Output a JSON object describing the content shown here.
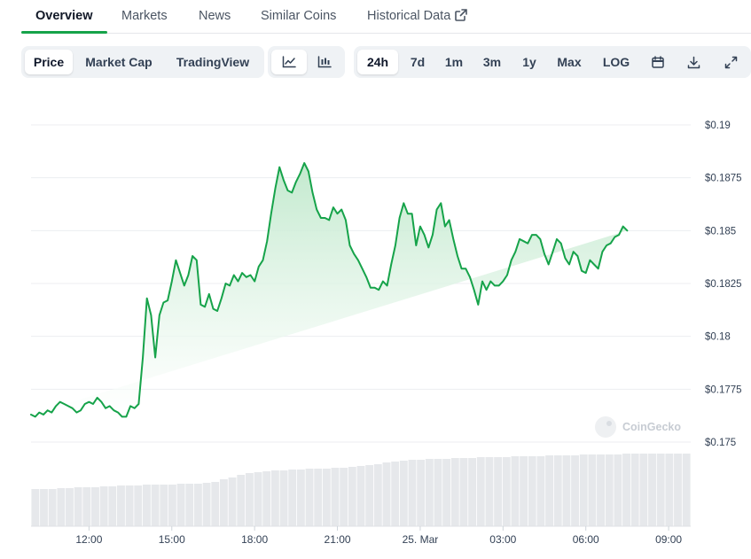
{
  "nav": {
    "tabs": [
      {
        "label": "Overview",
        "active": true
      },
      {
        "label": "Markets",
        "active": false
      },
      {
        "label": "News",
        "active": false
      },
      {
        "label": "Similar Coins",
        "active": false
      },
      {
        "label": "Historical Data",
        "active": false,
        "icon": "external-link-icon"
      }
    ]
  },
  "toolbar": {
    "chart_types": [
      {
        "label": "Price",
        "selected": true
      },
      {
        "label": "Market Cap",
        "selected": false
      },
      {
        "label": "TradingView",
        "selected": false
      }
    ],
    "styles": [
      {
        "icon": "line-chart-icon",
        "selected": true
      },
      {
        "icon": "candlestick-icon",
        "selected": false
      }
    ],
    "ranges": [
      {
        "label": "24h",
        "selected": true
      },
      {
        "label": "7d",
        "selected": false
      },
      {
        "label": "1m",
        "selected": false
      },
      {
        "label": "3m",
        "selected": false
      },
      {
        "label": "1y",
        "selected": false
      },
      {
        "label": "Max",
        "selected": false
      },
      {
        "label": "LOG",
        "selected": false
      }
    ],
    "actions": [
      {
        "icon": "calendar-icon"
      },
      {
        "icon": "download-icon"
      },
      {
        "icon": "fullscreen-icon"
      }
    ]
  },
  "watermark": "CoinGecko",
  "colors": {
    "accent": "#16a34a",
    "line": "#16a34a",
    "area_top": "#bfe8cb",
    "volume": "#e6e8eb"
  },
  "chart_data": {
    "type": "area",
    "grid": true,
    "ylim": [
      0.175,
      0.19
    ],
    "y_ticks": [
      "$0.19",
      "$0.1875",
      "$0.185",
      "$0.1825",
      "$0.18",
      "$0.1775",
      "$0.175"
    ],
    "y_tick_values": [
      0.19,
      0.1875,
      0.185,
      0.1825,
      0.18,
      0.1775,
      0.175
    ],
    "x_ticks": [
      "12:00",
      "15:00",
      "18:00",
      "21:00",
      "25. Mar",
      "03:00",
      "06:00",
      "09:00"
    ],
    "x_tick_hours": [
      12,
      15,
      18,
      21,
      24,
      27,
      30,
      33
    ],
    "xlim_hours": [
      9.9,
      33.8
    ],
    "series": [
      {
        "x_hours": [
          9.9,
          10.05,
          10.2,
          10.35,
          10.5,
          10.65,
          10.8,
          10.95,
          11.1,
          11.25,
          11.4,
          11.55,
          11.7,
          11.85,
          12.0,
          12.15,
          12.3,
          12.45,
          12.6,
          12.75,
          12.9,
          13.05,
          13.2,
          13.35,
          13.5,
          13.65,
          13.8,
          13.95,
          14.1,
          14.25,
          14.4,
          14.55,
          14.7,
          14.85,
          15.0,
          15.15,
          15.3,
          15.45,
          15.6,
          15.75,
          15.9,
          16.05,
          16.2,
          16.35,
          16.5,
          16.65,
          16.8,
          16.95,
          17.1,
          17.25,
          17.4,
          17.55,
          17.7,
          17.85,
          18.0,
          18.15,
          18.3,
          18.45,
          18.6,
          18.75,
          18.9,
          19.05,
          19.2,
          19.35,
          19.5,
          19.65,
          19.8,
          19.95,
          20.1,
          20.25,
          20.4,
          20.55,
          20.7,
          20.85,
          21.0,
          21.15,
          21.3,
          21.45,
          21.6,
          21.75,
          21.9,
          22.05,
          22.2,
          22.35,
          22.5,
          22.65,
          22.8,
          22.95,
          23.1,
          23.25,
          23.4,
          23.55,
          23.7,
          23.85,
          24.0,
          24.15,
          24.3,
          24.45,
          24.6,
          24.75,
          24.9,
          25.05,
          25.2,
          25.35,
          25.5,
          25.65,
          25.8,
          25.95,
          26.1,
          26.25,
          26.4,
          26.55,
          26.7,
          26.85,
          27.0,
          27.15,
          27.3,
          27.45,
          27.6,
          27.75,
          27.9,
          28.05,
          28.2,
          28.35,
          28.5,
          28.65,
          28.8,
          28.95,
          29.1,
          29.25,
          29.4,
          29.55,
          29.7,
          29.85,
          30.0,
          30.15,
          30.3,
          30.45,
          30.6,
          30.75,
          30.9,
          31.05,
          31.2,
          31.35,
          31.5,
          31.65,
          31.8,
          31.95,
          32.1,
          32.25,
          32.4,
          32.55,
          32.7,
          32.85,
          33.0,
          33.15,
          33.3,
          33.45,
          33.6,
          33.75
        ],
        "values": [
          0.1763,
          0.1762,
          0.1764,
          0.1763,
          0.1765,
          0.1764,
          0.1767,
          0.1769,
          0.1768,
          0.1767,
          0.1766,
          0.1764,
          0.1765,
          0.1768,
          0.1769,
          0.1768,
          0.1771,
          0.1769,
          0.1766,
          0.1767,
          0.1765,
          0.1764,
          0.1762,
          0.1762,
          0.1767,
          0.1766,
          0.1768,
          0.179,
          0.1818,
          0.181,
          0.179,
          0.181,
          0.1816,
          0.1817,
          0.1826,
          0.1836,
          0.183,
          0.1824,
          0.1829,
          0.1838,
          0.1836,
          0.1815,
          0.1814,
          0.182,
          0.1813,
          0.1812,
          0.1818,
          0.1825,
          0.1824,
          0.1829,
          0.1826,
          0.183,
          0.1828,
          0.1829,
          0.1826,
          0.1833,
          0.1836,
          0.1845,
          0.1858,
          0.187,
          0.188,
          0.1874,
          0.1869,
          0.1868,
          0.1873,
          0.1877,
          0.1882,
          0.1878,
          0.1868,
          0.186,
          0.1856,
          0.1856,
          0.1855,
          0.1861,
          0.1858,
          0.186,
          0.1855,
          0.1843,
          0.1839,
          0.1836,
          0.1832,
          0.1828,
          0.1823,
          0.1823,
          0.1822,
          0.1826,
          0.1824,
          0.1834,
          0.1843,
          0.1856,
          0.1863,
          0.1858,
          0.1858,
          0.1843,
          0.1852,
          0.1848,
          0.1842,
          0.1848,
          0.186,
          0.1863,
          0.1852,
          0.1855,
          0.1846,
          0.1838,
          0.1832,
          0.1832,
          0.1828,
          0.1822,
          0.1815,
          0.1826,
          0.1822,
          0.1826,
          0.1824,
          0.1824,
          0.1826,
          0.1829,
          0.1836,
          0.184,
          0.1846,
          0.1845,
          0.1844,
          0.1848,
          0.1848,
          0.1846,
          0.1839,
          0.1834,
          0.184,
          0.1846,
          0.1844,
          0.1837,
          0.1834,
          0.184,
          0.1838,
          0.1831,
          0.183,
          0.1836,
          0.1834,
          0.1832,
          0.184,
          0.1843,
          0.1844,
          0.1847,
          0.1848,
          0.1852,
          0.185
        ]
      }
    ],
    "volume": {
      "type": "bar",
      "unit": "relative 0-1",
      "values": [
        0.42,
        0.42,
        0.42,
        0.43,
        0.43,
        0.44,
        0.44,
        0.44,
        0.45,
        0.45,
        0.46,
        0.46,
        0.46,
        0.47,
        0.47,
        0.47,
        0.47,
        0.48,
        0.48,
        0.48,
        0.49,
        0.5,
        0.53,
        0.55,
        0.58,
        0.6,
        0.61,
        0.62,
        0.63,
        0.63,
        0.64,
        0.64,
        0.65,
        0.65,
        0.65,
        0.66,
        0.66,
        0.67,
        0.68,
        0.69,
        0.7,
        0.72,
        0.73,
        0.74,
        0.75,
        0.75,
        0.76,
        0.76,
        0.76,
        0.77,
        0.77,
        0.77,
        0.78,
        0.78,
        0.78,
        0.78,
        0.79,
        0.79,
        0.79,
        0.79,
        0.8,
        0.8,
        0.8,
        0.8,
        0.81,
        0.81,
        0.81,
        0.81,
        0.81,
        0.82,
        0.82,
        0.82,
        0.82,
        0.82,
        0.82,
        0.82,
        0.82
      ]
    }
  }
}
